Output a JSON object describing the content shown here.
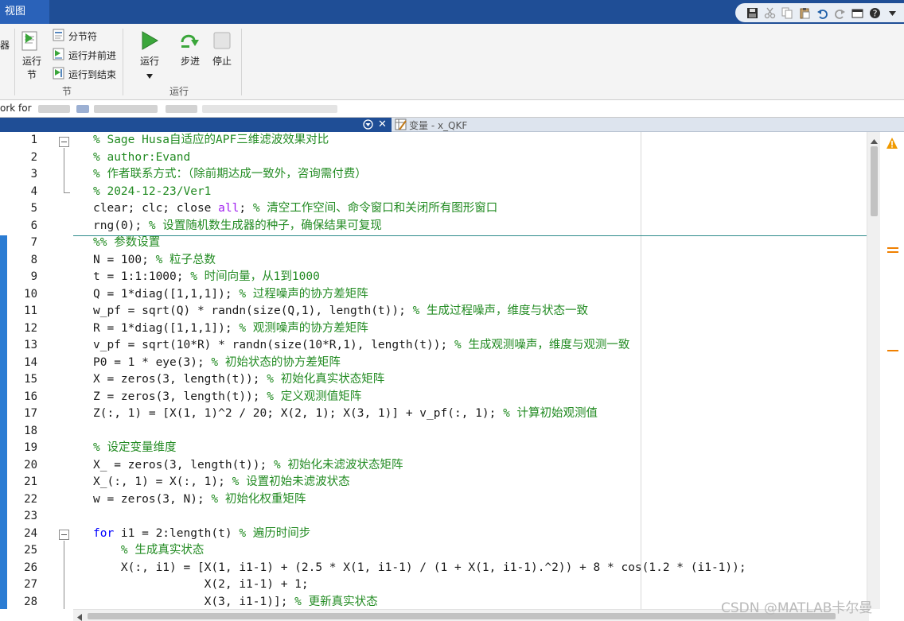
{
  "tabbar": {
    "active_tab": "视图"
  },
  "ribbon": {
    "cut_left_label": "器",
    "run_section": {
      "line1": "运行",
      "line2": "节"
    },
    "section_break": "分节符",
    "run_and_advance": "运行并前进",
    "run_to_end": "运行到结束",
    "group_section": "节",
    "run": "运行",
    "step": "步进",
    "stop": "停止",
    "group_run": "运行"
  },
  "address": {
    "visible_text": "ork for"
  },
  "editor": {
    "variable_tab": "变量 - x_QKF"
  },
  "watermark": "CSDN @MATLAB卡尔曼",
  "code": {
    "line_numbers": [
      "1",
      "2",
      "3",
      "4",
      "5",
      "6",
      "7",
      "8",
      "9",
      "10",
      "11",
      "12",
      "13",
      "14",
      "15",
      "16",
      "17",
      "18",
      "19",
      "20",
      "21",
      "22",
      "23",
      "24",
      "25",
      "26",
      "27",
      "28"
    ],
    "lines": [
      [
        [
          "c",
          "% Sage Husa自适应的APF三维滤波效果对比"
        ]
      ],
      [
        [
          "c",
          "% author:Evand"
        ]
      ],
      [
        [
          "c",
          "% 作者联系方式："
        ],
        [
          "c",
          "（除前期达成一致外，咨询需付费）"
        ]
      ],
      [
        [
          "c",
          "% 2024-12-23/Ver1"
        ]
      ],
      [
        [
          "n",
          "clear; clc; close "
        ],
        [
          "k2",
          "all"
        ],
        [
          "n",
          "; "
        ],
        [
          "c",
          "% 清空工作空间、命令窗口和关闭所有图形窗口"
        ]
      ],
      [
        [
          "n",
          "rng(0); "
        ],
        [
          "c",
          "% 设置随机数生成器的种子，确保结果可复现"
        ]
      ],
      [
        [
          "c",
          "%% 参数设置"
        ]
      ],
      [
        [
          "n",
          "N = 100; "
        ],
        [
          "c",
          "% 粒子总数"
        ]
      ],
      [
        [
          "n",
          "t = 1:1:1000; "
        ],
        [
          "c",
          "% 时间向量，从1到1000"
        ]
      ],
      [
        [
          "n",
          "Q = 1*diag([1,1,1]); "
        ],
        [
          "c",
          "% 过程噪声的协方差矩阵"
        ]
      ],
      [
        [
          "n",
          "w_pf = sqrt(Q) * randn(size(Q,1), length(t)); "
        ],
        [
          "c",
          "% 生成过程噪声，维度与状态一致"
        ]
      ],
      [
        [
          "n",
          "R = 1*diag([1,1,1]); "
        ],
        [
          "c",
          "% 观测噪声的协方差矩阵"
        ]
      ],
      [
        [
          "n",
          "v_pf = sqrt(10*R) * randn(size(10*R,1), length(t)); "
        ],
        [
          "c",
          "% 生成观测噪声，维度与观测一致"
        ]
      ],
      [
        [
          "n",
          "P0 = 1 * eye(3); "
        ],
        [
          "c",
          "% 初始状态的协方差矩阵"
        ]
      ],
      [
        [
          "n",
          "X = zeros(3, length(t)); "
        ],
        [
          "c",
          "% 初始化真实状态矩阵"
        ]
      ],
      [
        [
          "n",
          "Z = zeros(3, length(t)); "
        ],
        [
          "c",
          "% 定义观测值矩阵"
        ]
      ],
      [
        [
          "n",
          "Z(:, 1) = [X(1, 1)^2 / 20; X(2, 1); X(3, 1)] + v_pf(:, 1); "
        ],
        [
          "c",
          "% 计算初始观测值"
        ]
      ],
      [
        [
          "n",
          ""
        ]
      ],
      [
        [
          "c",
          "% 设定变量维度"
        ]
      ],
      [
        [
          "n",
          "X_ = zeros(3, length(t)); "
        ],
        [
          "c",
          "% 初始化未滤波状态矩阵"
        ]
      ],
      [
        [
          "n",
          "X_(:, 1) = X(:, 1); "
        ],
        [
          "c",
          "% 设置初始未滤波状态"
        ]
      ],
      [
        [
          "n",
          "w = zeros(3, N); "
        ],
        [
          "c",
          "% 初始化权重矩阵"
        ]
      ],
      [
        [
          "n",
          ""
        ]
      ],
      [
        [
          "k",
          "for "
        ],
        [
          "n",
          "i1 = 2:length(t) "
        ],
        [
          "c",
          "% 遍历时间步"
        ]
      ],
      [
        [
          "n",
          "    "
        ],
        [
          "c",
          "% 生成真实状态"
        ]
      ],
      [
        [
          "n",
          "    X(:, i1) = [X(1, i1-1) + (2.5 * X(1, i1-1) / (1 + X(1, i1-1).^2)) + 8 * cos(1.2 * (i1-1));"
        ]
      ],
      [
        [
          "n",
          "                X(2, i1-1) + 1;"
        ]
      ],
      [
        [
          "n",
          "                X(3, i1-1)]; "
        ],
        [
          "c",
          "% 更新真实状态"
        ]
      ]
    ]
  }
}
